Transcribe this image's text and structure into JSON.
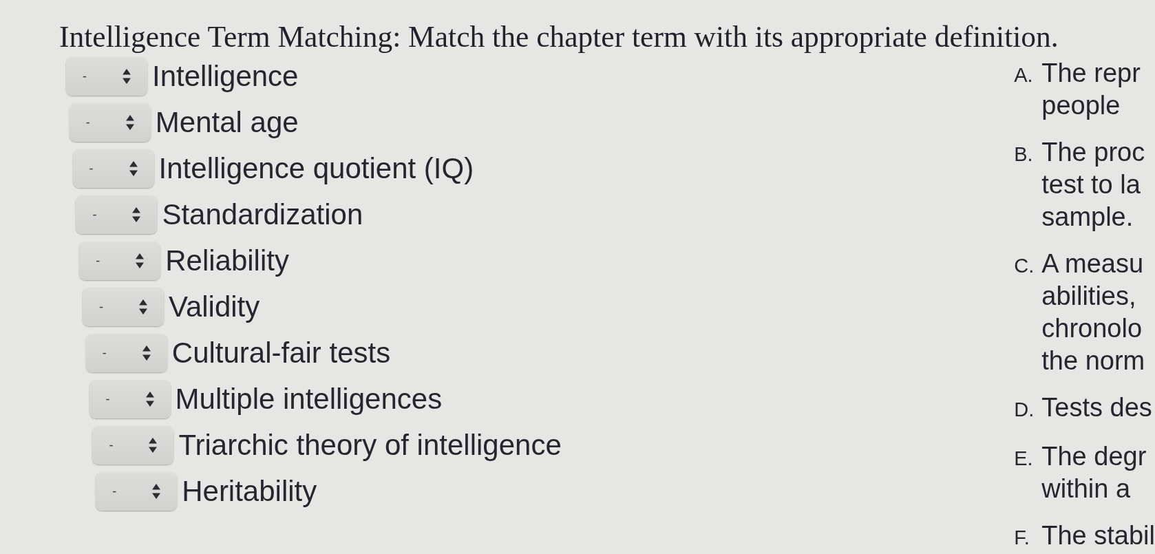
{
  "title": "Intelligence Term Matching: Match the chapter term with its appropriate definition.",
  "terms": [
    {
      "value": "-",
      "label": "Intelligence"
    },
    {
      "value": "-",
      "label": "Mental age"
    },
    {
      "value": "-",
      "label": "Intelligence quotient (IQ)"
    },
    {
      "value": "-",
      "label": "Standardization"
    },
    {
      "value": "-",
      "label": "Reliability"
    },
    {
      "value": "-",
      "label": "Validity"
    },
    {
      "value": "-",
      "label": "Cultural-fair tests"
    },
    {
      "value": "-",
      "label": "Multiple intelligences"
    },
    {
      "value": "-",
      "label": "Triarchic theory of intelligence"
    },
    {
      "value": "-",
      "label": "Heritability"
    }
  ],
  "definitions": [
    {
      "letter": "A.",
      "text": "The repr\npeople"
    },
    {
      "letter": "B.",
      "text": "The proc\ntest to la\nsample."
    },
    {
      "letter": "C.",
      "text": "A measu\nabilities,\nchronolo\nthe norm"
    },
    {
      "letter": "D.",
      "text": "Tests des"
    },
    {
      "letter": "E.",
      "text": "The degr\nwithin a"
    },
    {
      "letter": "F.",
      "text": "The stabil"
    }
  ]
}
